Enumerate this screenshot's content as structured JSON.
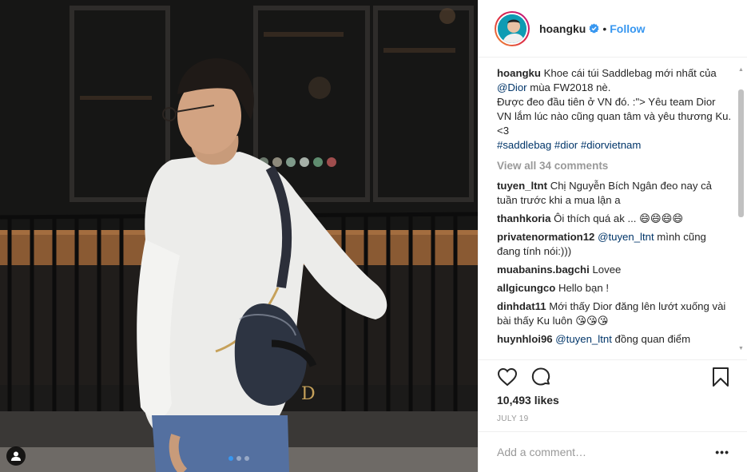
{
  "post": {
    "username": "hoangku",
    "follow_label": "Follow",
    "separator": "•",
    "caption": {
      "username": "hoangku",
      "text_1": "Khoe cái túi Saddlebag mới nhất của ",
      "mention": "@Dior",
      "text_2": " mùa FW2018 nè.",
      "line_2": "Được đeo đầu tiên ở VN đó. :\"> Yêu team Dior VN lắm lúc nào cũng quan tâm và yêu thương Ku. <3",
      "hashtags": [
        "#saddlebag",
        "#dior",
        "#diorvietnam"
      ]
    },
    "view_all_comments": "View all 34 comments",
    "comments": [
      {
        "user": "tuyen_ltnt",
        "mention": "",
        "text": "Chị Nguyễn Bích Ngân đeo nay cả tuần trước khi a mua lận a"
      },
      {
        "user": "thanhkoria",
        "mention": "",
        "text": "Ôi thích quá ak ... 😄😄😄😄"
      },
      {
        "user": "privatenormation12",
        "mention": "@tuyen_ltnt",
        "text": " mình cũng đang tính nói:)))"
      },
      {
        "user": "muabanins.bagchi",
        "mention": "",
        "text": "Lovee"
      },
      {
        "user": "allgicungco",
        "mention": "",
        "text": "Hello bạn !"
      },
      {
        "user": "dinhdat11",
        "mention": "",
        "text": "Mới thấy Dior đăng lên lướt xuống vài bài thấy Ku luôn 😘😘😘"
      },
      {
        "user": "huynhloi96",
        "mention": "@tuyen_ltnt",
        "text": " đồng quan điểm"
      }
    ],
    "likes": "10,493 likes",
    "date": "JULY 19",
    "add_comment_placeholder": "Add a comment…",
    "more_options": "•••",
    "carousel": {
      "count": 3,
      "active": 0
    }
  },
  "colors": {
    "accent": "#3897f0",
    "link": "#003569",
    "muted": "#999999"
  },
  "icons": [
    "user-tag-icon",
    "verified-badge-icon",
    "heart-icon",
    "comment-icon",
    "bookmark-icon"
  ]
}
